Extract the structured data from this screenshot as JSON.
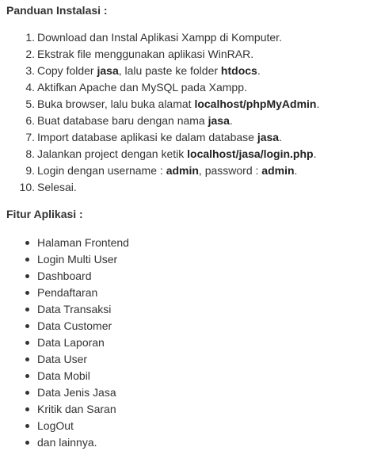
{
  "install": {
    "title": "Panduan Instalasi :",
    "steps": [
      {
        "num": "1.",
        "parts": [
          {
            "t": "Download dan Instal Aplikasi Xampp di Komputer.",
            "b": false
          }
        ]
      },
      {
        "num": "2.",
        "parts": [
          {
            "t": "Ekstrak file menggunakan aplikasi WinRAR.",
            "b": false
          }
        ]
      },
      {
        "num": "3.",
        "parts": [
          {
            "t": "Copy folder ",
            "b": false
          },
          {
            "t": "jasa",
            "b": true
          },
          {
            "t": ", lalu paste ke folder ",
            "b": false
          },
          {
            "t": "htdocs",
            "b": true
          },
          {
            "t": ".",
            "b": false
          }
        ]
      },
      {
        "num": "4.",
        "parts": [
          {
            "t": "Aktifkan Apache dan MySQL pada Xampp.",
            "b": false
          }
        ]
      },
      {
        "num": "5.",
        "parts": [
          {
            "t": "Buka browser, lalu buka alamat ",
            "b": false
          },
          {
            "t": "localhost/phpMyAdmin",
            "b": true
          },
          {
            "t": ".",
            "b": false
          }
        ]
      },
      {
        "num": "6.",
        "parts": [
          {
            "t": "Buat database baru dengan nama ",
            "b": false
          },
          {
            "t": "jasa",
            "b": true
          },
          {
            "t": ".",
            "b": false
          }
        ]
      },
      {
        "num": "7.",
        "parts": [
          {
            "t": "Import database aplikasi ke dalam database ",
            "b": false
          },
          {
            "t": "jasa",
            "b": true
          },
          {
            "t": ".",
            "b": false
          }
        ]
      },
      {
        "num": "8.",
        "parts": [
          {
            "t": "Jalankan project dengan ketik ",
            "b": false
          },
          {
            "t": "localhost/jasa/login.php",
            "b": true
          },
          {
            "t": ".",
            "b": false
          }
        ]
      },
      {
        "num": "9.",
        "parts": [
          {
            "t": "Login dengan username : ",
            "b": false
          },
          {
            "t": "admin",
            "b": true
          },
          {
            "t": ", password : ",
            "b": false
          },
          {
            "t": "admin",
            "b": true
          },
          {
            "t": ".",
            "b": false
          }
        ]
      },
      {
        "num": "10.",
        "parts": [
          {
            "t": "Selesai.",
            "b": false
          }
        ]
      }
    ]
  },
  "features": {
    "title": "Fitur Aplikasi :",
    "items": [
      "Halaman Frontend",
      "Login Multi User",
      "Dashboard",
      "Pendaftaran",
      "Data Transaksi",
      "Data Customer",
      "Data Laporan",
      "Data User",
      "Data Mobil",
      "Data Jenis Jasa",
      "Kritik dan Saran",
      "LogOut",
      "dan lainnya."
    ]
  }
}
